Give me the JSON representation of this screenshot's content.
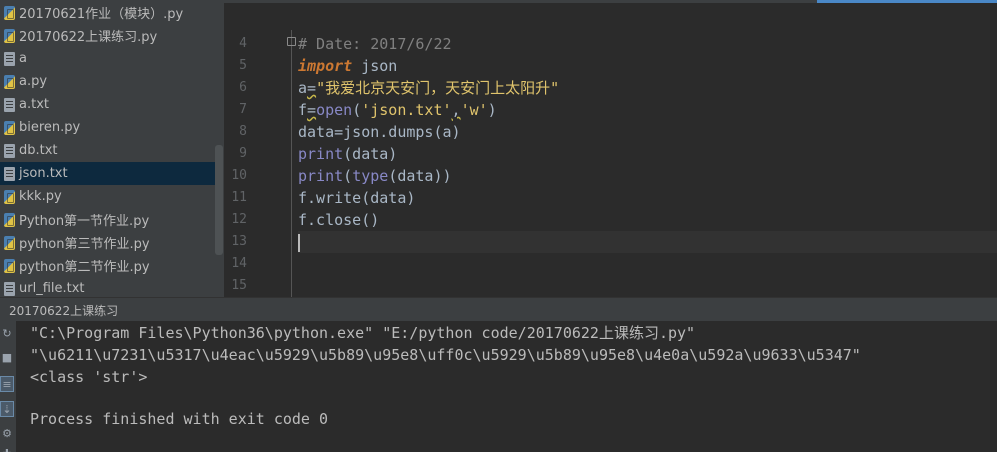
{
  "project_tree": {
    "items": [
      {
        "label": "20170621作业（模块）.py",
        "icon": "python-file-icon",
        "selected": false
      },
      {
        "label": "20170622上课练习.py",
        "icon": "python-file-icon",
        "selected": false
      },
      {
        "label": "a",
        "icon": "text-file-icon",
        "selected": false
      },
      {
        "label": "a.py",
        "icon": "python-file-icon",
        "selected": false
      },
      {
        "label": "a.txt",
        "icon": "text-file-icon",
        "selected": false
      },
      {
        "label": "bieren.py",
        "icon": "python-file-icon",
        "selected": false
      },
      {
        "label": "db.txt",
        "icon": "text-file-icon",
        "selected": false
      },
      {
        "label": "json.txt",
        "icon": "text-file-icon",
        "selected": true
      },
      {
        "label": "kkk.py",
        "icon": "python-file-icon",
        "selected": false
      },
      {
        "label": "Python第一节作业.py",
        "icon": "python-file-icon",
        "selected": false
      },
      {
        "label": "python第三节作业.py",
        "icon": "python-file-icon",
        "selected": false
      },
      {
        "label": "python第二节作业.py",
        "icon": "python-file-icon",
        "selected": false
      },
      {
        "label": "url_file.txt",
        "icon": "text-file-icon",
        "selected": false
      }
    ]
  },
  "editor": {
    "line_numbers": [
      "4",
      "5",
      "6",
      "7",
      "8",
      "9",
      "10",
      "11",
      "12",
      "13",
      "14",
      "15"
    ],
    "code": {
      "l4_comment": "# Date: 2017/6/22",
      "l5_kw": "import",
      "l5_rest": " json",
      "l6_a": "a",
      "l6_eq": "=",
      "l6_str": "\"我爱北京天安门，天安门上太阳升\"",
      "l7_f": "f",
      "l7_eq": "=",
      "l7_fn": "open",
      "l7_open": "(",
      "l7_s1": "'json.txt'",
      "l7_comma": ",",
      "l7_s2": "'w'",
      "l7_close": ")",
      "l8": "data=json.dumps(a)",
      "l9_fn": "print",
      "l9_rest": "(data)",
      "l10_fn": "print",
      "l10_mid": "(",
      "l10_fn2": "type",
      "l10_rest": "(data))",
      "l11": "f.write(data)",
      "l12": "f.close()"
    }
  },
  "run_panel": {
    "title": "20170622上课练习",
    "output": [
      "\"C:\\Program Files\\Python36\\python.exe\" \"E:/python code/20170622上课练习.py\"",
      "\"\\u6211\\u7231\\u5317\\u4eac\\u5929\\u5b89\\u95e8\\uff0c\\u5929\\u5b89\\u95e8\\u4e0a\\u592a\\u9633\\u5347\"",
      "<class 'str'>",
      "",
      "Process finished with exit code 0"
    ],
    "toolbar": [
      {
        "icon": "rerun-icon"
      },
      {
        "icon": "stop-icon"
      },
      {
        "icon": "pause-output-icon"
      },
      {
        "icon": "dump-threads-icon"
      },
      {
        "icon": "settings-icon"
      },
      {
        "icon": "pin-icon"
      }
    ]
  },
  "colors": {
    "background": "#2b2b2b",
    "panel": "#3c3f41",
    "selection": "#0d293e",
    "keyword": "#cc7832",
    "string": "#6a8759",
    "builtin": "#8888c6",
    "comment": "#808080",
    "accent": "#4a88c7"
  }
}
